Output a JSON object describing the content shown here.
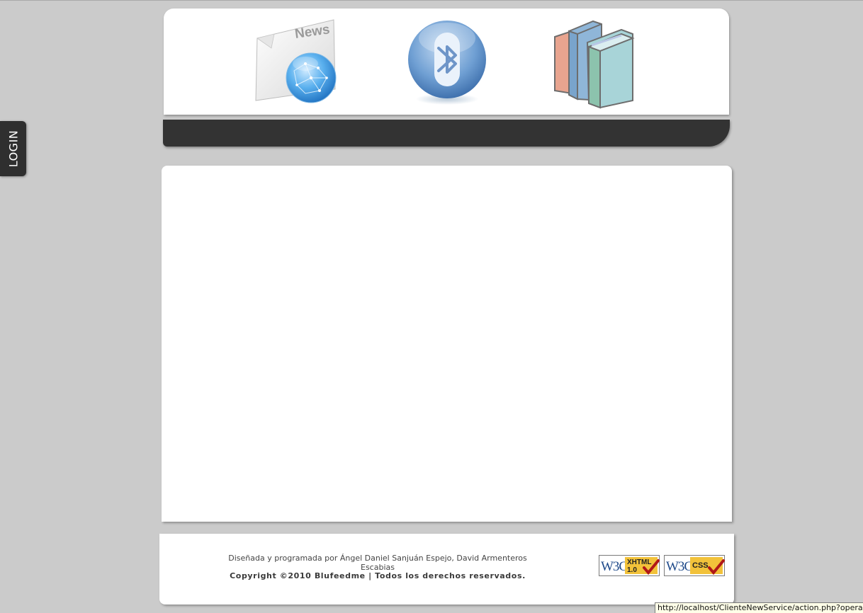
{
  "login": {
    "label": "LOGIN"
  },
  "header": {
    "icons": [
      {
        "name": "news-icon",
        "text": "News"
      },
      {
        "name": "bluetooth-icon"
      },
      {
        "name": "books-icon"
      }
    ]
  },
  "footer": {
    "credit": "Diseñada y programada por Ángel Daniel Sanjuán Espejo, David Armenteros Escabias",
    "copyright": "Copyright ©2010 Blufeedme | Todos los derechos reservados.",
    "badges": [
      {
        "w3c": "W3C",
        "label": "XHTML",
        "version": "1.0"
      },
      {
        "w3c": "W3C",
        "label": "CSS"
      }
    ]
  },
  "status": {
    "url": "http://localhost/ClienteNewService/action.php?operacion=cc"
  },
  "colors": {
    "background": "#cbcbcb",
    "nav_bar": "#333333",
    "login_tab": "#2f2f2f",
    "badge_gold": "#f2c23a",
    "badge_blue": "#1f4a8a"
  }
}
